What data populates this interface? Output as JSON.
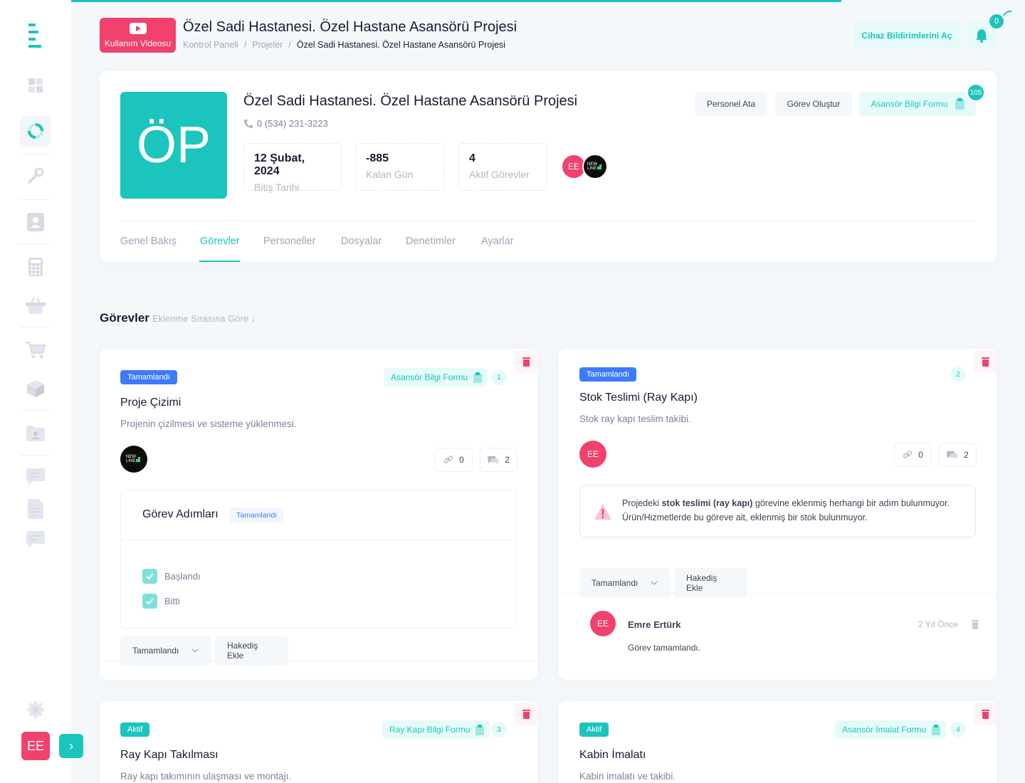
{
  "header": {
    "video_button": "Kullanım Videosu",
    "title": "Özel Sadi Hastanesi. Özel Hastane Asansörü Projesi",
    "breadcrumb": [
      "Kontrol Paneli",
      "Projeler",
      "Özel Sadi Hastanesi. Özel Hastane Asansörü Projesi"
    ],
    "device_notifications_button": "Cihaz Bildirimlerini Aç",
    "notification_count": "0"
  },
  "sidebar": {
    "user_initials": "EE"
  },
  "project": {
    "initials": "ÖP",
    "name": "Özel Sadi Hastanesi. Özel Hastane Asansörü Projesi",
    "phone": "0 (534) 231-3223",
    "stats": [
      {
        "value": "12 Şubat, 2024",
        "label": "Bitiş Tarihi"
      },
      {
        "value": "-885",
        "label": "Kalan Gün"
      },
      {
        "value": "4",
        "label": "Aktif Görevler"
      }
    ],
    "member_initials": "EE",
    "member_logo_text": "NEW LINE",
    "actions": {
      "assign_staff": "Personel Ata",
      "create_task": "Görev Oluştur",
      "form": "Asansör Bilgi Formu",
      "form_count": "105"
    },
    "tabs": [
      "Genel Bakış",
      "Görevler",
      "Personeller",
      "Dosyalar",
      "Denetimler",
      "Ayarlar"
    ],
    "active_tab": "Görevler"
  },
  "tasks_section": {
    "title": "Görevler",
    "sort_label": "Eklenme Sırasına Göre ↓"
  },
  "tasks": [
    {
      "status": "Tamamlandı",
      "form": "Asansör Bilgi Formu",
      "number": "1",
      "title": "Proje Çizimi",
      "description": "Projenin çizilmesi ve sisteme yüklenmesi.",
      "links": "0",
      "comments": "2",
      "steps_title": "Görev Adımları",
      "steps_status": "Tamamlandı",
      "steps": [
        "Başlandı",
        "Bitti"
      ],
      "status_select": "Tamamlandı",
      "progress_button": "Hakediş Ekle"
    },
    {
      "status": "Tamamlandı",
      "number": "2",
      "title": "Stok Teslimi (Ray Kapı)",
      "description": "Stok ray kapı teslim takibi.",
      "assignee": "EE",
      "links": "0",
      "comments": "2",
      "alert_prefix": "Projedeki ",
      "alert_bold": "stok teslimi (ray kapı)",
      "alert_suffix": " görevine eklenmiş herhangi bir adım bulunmuyor.",
      "alert_line2": "Ürün/Hizmetlerde bu göreve ait, eklenmiş bir stok bulunmuyor.",
      "status_select": "Tamamlandı",
      "progress_button": "Hakediş Ekle",
      "comment": {
        "initials": "EE",
        "author": "Emre Ertürk",
        "time": "2 Yıl Önce",
        "text": "Görev tamamlandı."
      }
    },
    {
      "status": "Aktif",
      "form": "Ray Kapı Bilgi Formu",
      "number": "3",
      "title": "Ray Kapı Takılması",
      "description": "Ray kapı takımının ulaşması ve montajı."
    },
    {
      "status": "Aktif",
      "form": "Asansör İmalat Formu",
      "number": "4",
      "title": "Kabin İmalatı",
      "description": "Kabin imalatı ve takibi."
    }
  ],
  "colors": {
    "accent": "#1bc5bd",
    "danger": "#f1416c",
    "primary": "#3e7bfa"
  }
}
